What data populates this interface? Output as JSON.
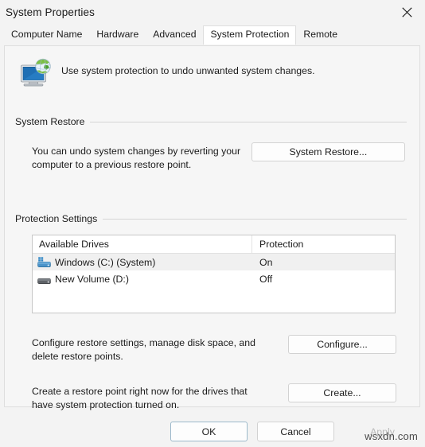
{
  "window": {
    "title": "System Properties",
    "close_icon": "close-icon"
  },
  "tabs": [
    {
      "label": "Computer Name",
      "active": false
    },
    {
      "label": "Hardware",
      "active": false
    },
    {
      "label": "Advanced",
      "active": false
    },
    {
      "label": "System Protection",
      "active": true
    },
    {
      "label": "Remote",
      "active": false
    }
  ],
  "header": {
    "icon": "system-protection-icon",
    "description": "Use system protection to undo unwanted system changes."
  },
  "system_restore": {
    "group_title": "System Restore",
    "description": "You can undo system changes by reverting your computer to a previous restore point.",
    "button_label": "System Restore..."
  },
  "protection_settings": {
    "group_title": "Protection Settings",
    "columns": [
      "Available Drives",
      "Protection"
    ],
    "drives": [
      {
        "name": "Windows (C:) (System)",
        "protection": "On",
        "icon": "windows-drive-icon",
        "selected": true
      },
      {
        "name": "New Volume (D:)",
        "protection": "Off",
        "icon": "hard-drive-icon",
        "selected": false
      }
    ],
    "configure": {
      "description": "Configure restore settings, manage disk space, and delete restore points.",
      "button_label": "Configure..."
    },
    "create": {
      "description": "Create a restore point right now for the drives that have system protection turned on.",
      "button_label": "Create..."
    }
  },
  "footer": {
    "ok_label": "OK",
    "cancel_label": "Cancel",
    "apply_label": "Apply"
  },
  "watermark": "wsxdn.com",
  "colors": {
    "dialog_bg": "#f3f3f3",
    "panel_bg": "#f6f6f6",
    "accent_border": "#9ab7c9",
    "selection_row": "#f0f0f0",
    "drive_blue": "#3c82b4"
  }
}
